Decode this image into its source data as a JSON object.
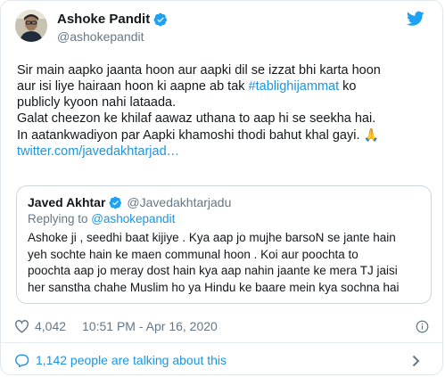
{
  "tweet": {
    "author_name": "Ashoke Pandit",
    "author_handle": "@ashokepandit",
    "lines": [
      {
        "parts": [
          {
            "text": "Sir main aapko jaanta hoon aur aapki dil se izzat bhi karta hoon",
            "link": false
          }
        ]
      },
      {
        "parts": [
          {
            "text": "aur isi liye hairaan hoon ki aapne ab tak ",
            "link": false
          },
          {
            "text": "#tablighijammat",
            "link": true
          },
          {
            "text": " ko",
            "link": false
          }
        ]
      },
      {
        "parts": [
          {
            "text": "publicly kyoon nahi lataada.",
            "link": false
          }
        ]
      },
      {
        "parts": [
          {
            "text": "Galat cheezon ke khilaf aawaz uthana to aap hi se seekha hai.",
            "link": false
          }
        ]
      },
      {
        "parts": [
          {
            "text": "In aatankwadiyon par Aapki khamoshi thodi bahut khal gayi.",
            "link": false
          }
        ]
      },
      {
        "parts": [
          {
            "text": "twitter.com/javedakhtarjad…",
            "link": true
          }
        ]
      }
    ],
    "emoji": "🙏"
  },
  "quote": {
    "author_name": "Javed Akhtar",
    "author_handle": "@Javedakhtarjadu",
    "replying_prefix": "Replying to ",
    "replying_to": "@ashokepandit",
    "lines": [
      "Ashoke ji , seedhi baat kijiye . Kya aap jo mujhe barsoN se jante hain",
      "yeh sochte  hain ke maen communal hoon . Koi aur poochta to",
      "poochta aap jo meray dost hain kya aap nahin jaante ke mera TJ jaisi",
      "her sanstha chahe  Muslim ho ya Hindu ke baare mein kya sochna hai"
    ]
  },
  "meta": {
    "likes": "4,042",
    "timestamp": "10:51 PM - Apr 16, 2020"
  },
  "talking": {
    "label": "1,142 people are talking about this"
  },
  "icons": {
    "verified": "verified-badge-icon",
    "twitter": "twitter-bird-icon",
    "like": "heart-icon",
    "info": "info-icon",
    "talking": "speech-bubble-icon",
    "chevron": "chevron-right-icon"
  },
  "colors": {
    "link": "#1b95e0",
    "secondary_text": "#657786",
    "verified": "#1da1f2",
    "twitter_blue": "#1da1f2"
  }
}
